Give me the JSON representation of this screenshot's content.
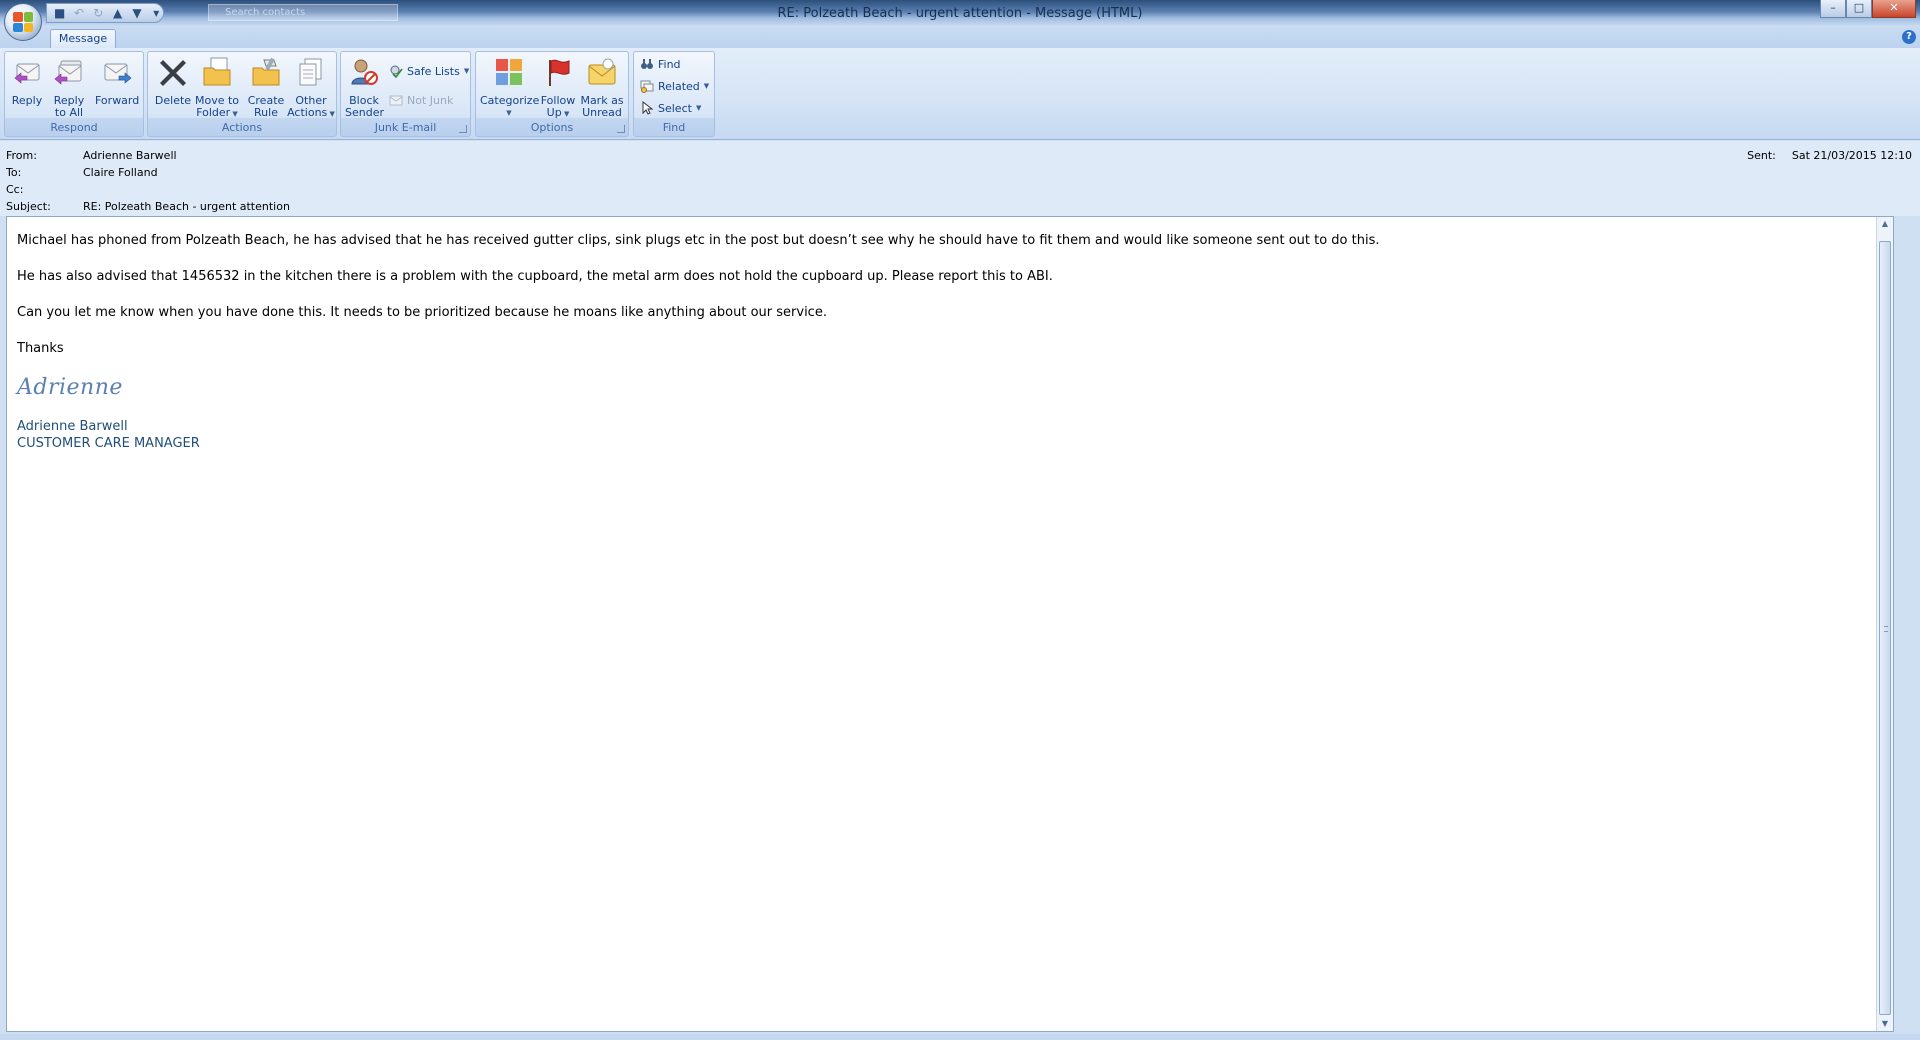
{
  "window": {
    "title": "RE: Polzeath Beach - urgent attention - Message (HTML)",
    "controls": {
      "minimize": "–",
      "maximize": "□",
      "close": "✕"
    }
  },
  "quick_access": {
    "search_placeholder": "Search contacts"
  },
  "tabs": [
    {
      "label": "Message"
    }
  ],
  "ribbon": {
    "groups": {
      "respond": {
        "label": "Respond",
        "reply": "Reply",
        "reply_all": "Reply to All",
        "forward": "Forward"
      },
      "actions": {
        "label": "Actions",
        "delete": "Delete",
        "move_to_folder": "Move to Folder",
        "create_rule": "Create Rule",
        "other_actions": "Other Actions"
      },
      "junk": {
        "label": "Junk E-mail",
        "block_sender": "Block Sender",
        "safe_lists": "Safe Lists",
        "not_junk": "Not Junk"
      },
      "options": {
        "label": "Options",
        "categorize": "Categorize",
        "follow_up": "Follow Up",
        "mark_unread": "Mark as Unread"
      },
      "find": {
        "label": "Find",
        "find": "Find",
        "related": "Related",
        "select": "Select"
      }
    }
  },
  "header": {
    "from_label": "From:",
    "from": "Adrienne Barwell",
    "to_label": "To:",
    "to": "Claire Folland",
    "cc_label": "Cc:",
    "cc": "",
    "subject_label": "Subject:",
    "subject": "RE: Polzeath Beach - urgent attention",
    "sent_label": "Sent:",
    "sent": "Sat 21/03/2015 12:10"
  },
  "body": {
    "paragraphs": [
      "Michael has phoned from Polzeath Beach, he has advised that he has received gutter clips, sink plugs etc in the post but doesn’t see why he should have to fit them and would like someone sent out to do this.",
      "He has also advised that 1456532 in the kitchen there is a problem with the cupboard, the metal arm does not hold the cupboard up. Please report this to ABI.",
      "Can you let me know when you have done this.  It needs to be prioritized because he moans like anything about our service.",
      "Thanks"
    ],
    "signature_script": "Adrienne",
    "signature_name": "Adrienne Barwell",
    "signature_title": "CUSTOMER CARE MANAGER"
  },
  "colors": {
    "accent": "#15428b",
    "ribbon_bg": "#d4e3f6",
    "signature": "#1f4e79"
  }
}
